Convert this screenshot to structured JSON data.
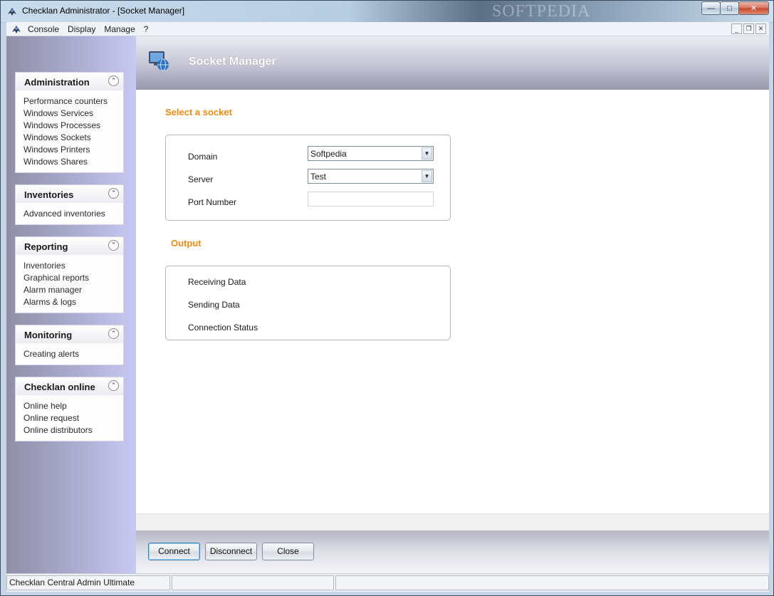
{
  "window": {
    "title": "Checklan Administrator - [Socket Manager]",
    "watermark": "SOFTPEDIA",
    "controls": {
      "minimize": "—",
      "maximize": "□",
      "close": "✕"
    }
  },
  "menu": {
    "items": [
      "Console",
      "Display",
      "Manage",
      "?"
    ],
    "mdi_controls": {
      "minimize": "_",
      "restore": "❐",
      "close": "✕"
    }
  },
  "sidebar": {
    "panels": [
      {
        "title": "Administration",
        "links": [
          "Performance counters",
          "Windows Services",
          "Windows Processes",
          "Windows Sockets",
          "Windows Printers",
          "Windows Shares"
        ]
      },
      {
        "title": "Inventories",
        "links": [
          "Advanced inventories"
        ]
      },
      {
        "title": "Reporting",
        "links": [
          "Inventories",
          "Graphical reports",
          "Alarm manager",
          "Alarms & logs"
        ]
      },
      {
        "title": "Monitoring",
        "links": [
          "Creating alerts"
        ]
      },
      {
        "title": "Checklan online",
        "links": [
          "Online help",
          "Online request",
          "Online distributors"
        ]
      }
    ],
    "collapse_glyph": "⌃"
  },
  "main": {
    "header_title": "Socket Manager",
    "select_section": {
      "title": "Select a socket",
      "domain_label": "Domain",
      "domain_value": "Softpedia",
      "server_label": "Server",
      "server_value": "Test",
      "port_label": "Port Number",
      "port_value": ""
    },
    "output_section": {
      "title": "Output",
      "receiving_label": "Receiving Data",
      "sending_label": "Sending Data",
      "status_label": "Connection Status"
    },
    "buttons": {
      "connect": "Connect",
      "disconnect": "Disconnect",
      "close": "Close"
    }
  },
  "statusbar": {
    "cell1": "Checklan Central Admin Ultimate",
    "cell2": "",
    "cell3": ""
  },
  "colors": {
    "accent_orange": "#f08a10",
    "sidebar_lavender": "#c8c8f4",
    "header_gray": "#9797ab"
  }
}
